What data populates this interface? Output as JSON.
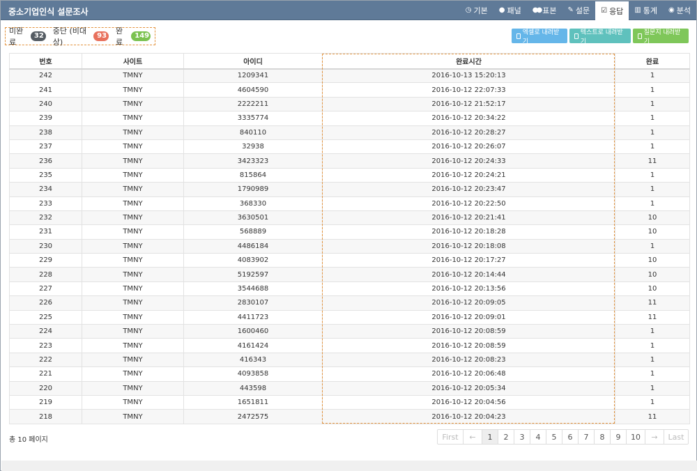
{
  "app": {
    "title": "중소기업인식 설문조사"
  },
  "nav": [
    {
      "label": "기본",
      "icon": "clock-icon"
    },
    {
      "label": "패널",
      "icon": "user-icon"
    },
    {
      "label": "표본",
      "icon": "users-icon"
    },
    {
      "label": "설문",
      "icon": "pencil-icon"
    },
    {
      "label": "응답",
      "icon": "check-square-icon",
      "active": true
    },
    {
      "label": "통계",
      "icon": "bar-chart-icon"
    },
    {
      "label": "분석",
      "icon": "eye-icon"
    }
  ],
  "status": {
    "incomplete_label": "미완료",
    "incomplete_count": "32",
    "stopped_label": "중단 (비대상)",
    "stopped_count": "93",
    "complete_label": "완료",
    "complete_count": "149"
  },
  "downloads": {
    "excel": "엑셀로 내려받기",
    "text": "텍스트로 내려받기",
    "survey": "질문지 내려받기"
  },
  "table": {
    "headers": [
      "번호",
      "사이트",
      "아이디",
      "완료시간",
      "완료"
    ],
    "rows": [
      [
        "242",
        "TMNY",
        "1209341",
        "2016-10-13 15:20:13",
        "1"
      ],
      [
        "241",
        "TMNY",
        "4604590",
        "2016-10-12 22:07:33",
        "1"
      ],
      [
        "240",
        "TMNY",
        "2222211",
        "2016-10-12 21:52:17",
        "1"
      ],
      [
        "239",
        "TMNY",
        "3335774",
        "2016-10-12 20:34:22",
        "1"
      ],
      [
        "238",
        "TMNY",
        "840110",
        "2016-10-12 20:28:27",
        "1"
      ],
      [
        "237",
        "TMNY",
        "32938",
        "2016-10-12 20:26:07",
        "1"
      ],
      [
        "236",
        "TMNY",
        "3423323",
        "2016-10-12 20:24:33",
        "11"
      ],
      [
        "235",
        "TMNY",
        "815864",
        "2016-10-12 20:24:21",
        "1"
      ],
      [
        "234",
        "TMNY",
        "1790989",
        "2016-10-12 20:23:47",
        "1"
      ],
      [
        "233",
        "TMNY",
        "368330",
        "2016-10-12 20:22:50",
        "1"
      ],
      [
        "232",
        "TMNY",
        "3630501",
        "2016-10-12 20:21:41",
        "10"
      ],
      [
        "231",
        "TMNY",
        "568889",
        "2016-10-12 20:18:28",
        "10"
      ],
      [
        "230",
        "TMNY",
        "4486184",
        "2016-10-12 20:18:08",
        "1"
      ],
      [
        "229",
        "TMNY",
        "4083902",
        "2016-10-12 20:17:27",
        "10"
      ],
      [
        "228",
        "TMNY",
        "5192597",
        "2016-10-12 20:14:44",
        "10"
      ],
      [
        "227",
        "TMNY",
        "3544688",
        "2016-10-12 20:13:56",
        "10"
      ],
      [
        "226",
        "TMNY",
        "2830107",
        "2016-10-12 20:09:05",
        "11"
      ],
      [
        "225",
        "TMNY",
        "4411723",
        "2016-10-12 20:09:01",
        "11"
      ],
      [
        "224",
        "TMNY",
        "1600460",
        "2016-10-12 20:08:59",
        "1"
      ],
      [
        "223",
        "TMNY",
        "4161424",
        "2016-10-12 20:08:59",
        "1"
      ],
      [
        "222",
        "TMNY",
        "416343",
        "2016-10-12 20:08:23",
        "1"
      ],
      [
        "221",
        "TMNY",
        "4093858",
        "2016-10-12 20:06:48",
        "1"
      ],
      [
        "220",
        "TMNY",
        "443598",
        "2016-10-12 20:05:34",
        "1"
      ],
      [
        "219",
        "TMNY",
        "1651811",
        "2016-10-12 20:04:56",
        "1"
      ],
      [
        "218",
        "TMNY",
        "2472575",
        "2016-10-12 20:04:23",
        "11"
      ]
    ]
  },
  "footer": {
    "total_pages": "총 10 페이지",
    "pager": {
      "first": "First",
      "prev": "←",
      "next": "→",
      "last": "Last",
      "pages": [
        "1",
        "2",
        "3",
        "4",
        "5",
        "6",
        "7",
        "8",
        "9",
        "10"
      ],
      "current": "1"
    }
  },
  "colors": {
    "header_bg": "#5f7a98",
    "badge_incomplete": "#555c63",
    "badge_stopped": "#e8705c",
    "badge_complete": "#7bc250",
    "excel_btn": "#65b6e9",
    "text_btn": "#5fc1bd",
    "survey_btn": "#7fc75a",
    "highlight_border": "#e3923c"
  }
}
